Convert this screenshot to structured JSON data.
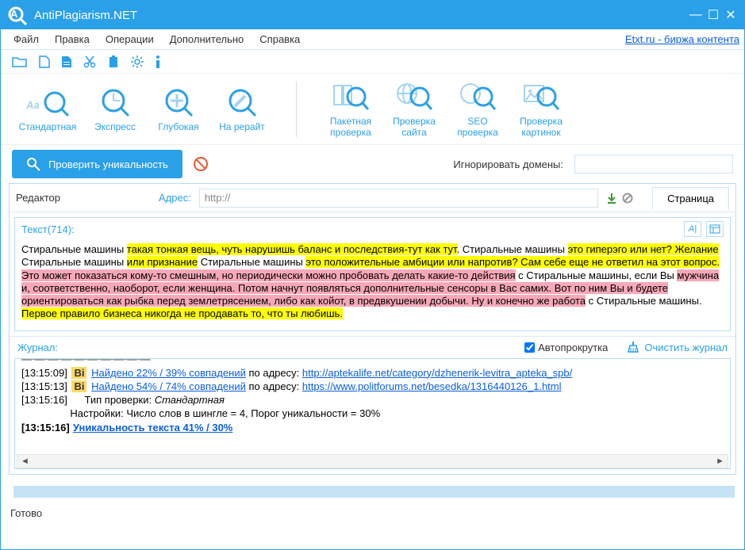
{
  "app": {
    "title": "AntiPlagiarism.NET"
  },
  "window": {
    "min": "—",
    "max": "☐",
    "close": "✕"
  },
  "menu": {
    "file": "Файл",
    "edit": "Правка",
    "operations": "Операции",
    "extras": "Дополнительно",
    "help": "Справка",
    "etxt_link": "Etxt.ru - биржа контента"
  },
  "modes": {
    "standard": "Стандартная",
    "express": "Экспресс",
    "deep": "Глубокая",
    "rewrite": "На рерайт",
    "batch": "Пакетная\nпроверка",
    "site": "Проверка\nсайта",
    "seo": "SEO\nпроверка",
    "images": "Проверка\nкартинок"
  },
  "actions": {
    "check": "Проверить уникальность",
    "ignore_label": "Игнорировать домены:"
  },
  "editor": {
    "label": "Редактор",
    "addr_label": "Адрес:",
    "addr_value": "http://",
    "page_tab": "Страница",
    "text_label": "Текст(714):"
  },
  "text_content": {
    "p1_plain1": "Стиральные машины ",
    "p1_hl1": "такая тонкая вещь, чуть нарушишь баланс и последствия-тут как тут",
    "p1_plain2": ". Стиральные машины ",
    "p1_hl2": "это гиперэго или нет? Желание",
    "p2_plain1": " Стиральные машины ",
    "p2_hl1": "или признание",
    "p2_plain2": " Стиральные машины ",
    "p2_hl2": "это положительные амбиции или напротив? Сам себе еще не ответил на этот вопрос. ",
    "p3_hl1": "Это может показаться кому-то смешным, но периодически можно пробовать делать какие-то действия",
    "p3_plain1": " с Стиральные машины, если Вы ",
    "p3_hl2": "мужчина и, соответственно, наоборот, если женщина. Потом начнут появляться дополнительные сенсоры в Вас самих. Вот по ним Вы и будете ориентироваться как рыбка перед землетрясением, либо как койот, в предвкушении добычи. Ну и конечно же работа",
    "p3_plain2": " с Стиральные машины.",
    "p4_hl1": " Первое правило бизнеса никогда не продавать то, что ты любишь."
  },
  "journal": {
    "label": "Журнал:",
    "auto": "Автопрокрутка",
    "clear": "Очистить журнал",
    "lines": [
      {
        "ts": "[13:15:09]",
        "bi": "Bi",
        "found": "Найдено 22% / 39% совпадений",
        "at": " по адресу: ",
        "url": "http://aptekalife.net/category/dzhenerik-levitra_apteka_spb/"
      },
      {
        "ts": "[13:15:13]",
        "bi": "Bi",
        "found": "Найдено 54% / 74% совпадений",
        "at": " по адресу: ",
        "url": "https://www.politforums.net/besedka/1316440126_1.html"
      },
      {
        "ts": "[13:15:16]",
        "plain": "Тип проверки: ",
        "italic": "Стандартная"
      },
      {
        "ts": "",
        "plain2": "                 Настройки: Число слов в шингле = 4, Порог уникальности = 30%"
      },
      {
        "ts": "[13:15:16]",
        "strong": "Уникальность текста 41% / 30%"
      }
    ]
  },
  "status": {
    "ready": "Готово"
  }
}
